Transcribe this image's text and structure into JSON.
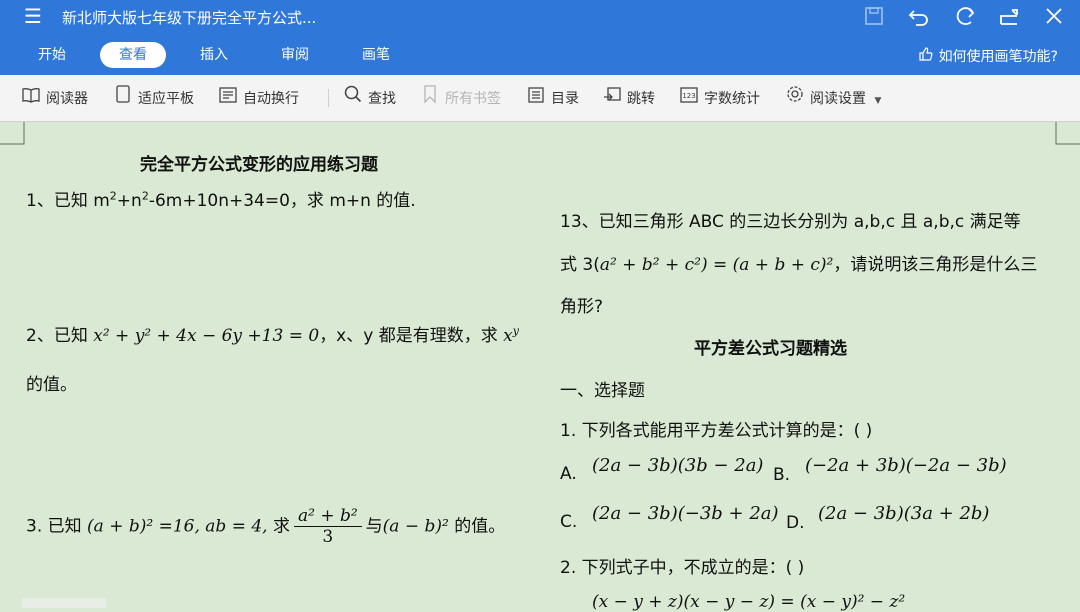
{
  "topbar": {
    "menu_icon": "menu-icon",
    "title": "新北师大版七年级下册完全平方公式...",
    "icons": [
      "save-icon",
      "undo-icon",
      "redo-icon",
      "share-icon",
      "close-icon"
    ],
    "tabs": [
      {
        "label": "开始"
      },
      {
        "label": "查看",
        "active": true
      },
      {
        "label": "插入"
      },
      {
        "label": "审阅"
      },
      {
        "label": "画笔"
      }
    ],
    "help": "如何使用画笔功能?",
    "accent": "#2f78d9"
  },
  "toolbar": {
    "items": [
      {
        "label": "阅读器",
        "icon": "book-icon"
      },
      {
        "label": "适应平板",
        "icon": "tablet-icon"
      },
      {
        "label": "自动换行",
        "icon": "wrap-icon"
      },
      {
        "label": "查找",
        "icon": "search-icon"
      },
      {
        "label": "所有书签",
        "icon": "bookmark-icon",
        "disabled": true
      },
      {
        "label": "目录",
        "icon": "toc-icon"
      },
      {
        "label": "跳转",
        "icon": "jump-icon"
      },
      {
        "label": "字数统计",
        "icon": "count-icon"
      },
      {
        "label": "阅读设置",
        "icon": "settings-icon"
      }
    ]
  },
  "doc": {
    "left": {
      "heading": "完全平方公式变形的应用练习题",
      "q1_a": "1、已知 m",
      "q1_sup1": "2",
      "q1_b": "+n",
      "q1_sup2": "2",
      "q1_c": "-6m+10n+34=0，求 m+n 的值.",
      "q2_a": "2、已知",
      "q2_expr": "x² + y² + 4x − 6y +13 = 0",
      "q2_b": "，x、y 都是有理数，求",
      "q2_x": "x",
      "q2_sup": "y",
      "q2_c": "的值。",
      "q3_a": "3.  已知",
      "q3_expr1": "(a + b)² =16, ab = 4,",
      "q3_b": "求",
      "q3_num": "a² + b²",
      "q3_den": "3",
      "q3_c": "与",
      "q3_expr2": "(a − b)²",
      "q3_d": "的值。"
    },
    "right": {
      "q13_line1": "13、已知三角形    ABC 的三边长分别为 a,b,c 且 a,b,c 满足等",
      "q13_line2_a": "式 3(",
      "q13_line2_expr": "a² + b² + c²) = (a + b + c)²",
      "q13_line2_b": "，请说明该三角形是什么三",
      "q13_line3": "角形?",
      "heading2": "平方差公式习题精选",
      "section": "一、选择题",
      "c1": "1.  下列各式能用平方差公式计算的是：(     )",
      "optA_label": "A.",
      "optA": "(2a − 3b)(3b − 2a)",
      "optB_label": "B.",
      "optB": "(−2a + 3b)(−2a − 3b)",
      "optC_label": "C.",
      "optC": "(2a − 3b)(−3b + 2a)",
      "optD_label": "D.",
      "optD": "(2a − 3b)(3a + 2b)",
      "c2": "2.  下列式子中，不成立的是：(     )",
      "c2_expr": "(x − y + z)(x − y − z) = (x − y)² − z²"
    }
  }
}
